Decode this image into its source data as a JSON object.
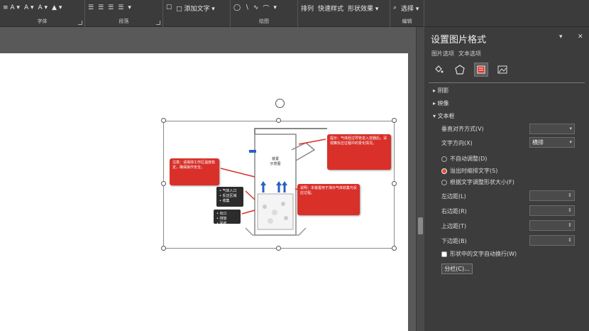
{
  "ribbon": {
    "groups": [
      {
        "label": "字体",
        "tools": [
          "≡ A ▾",
          "A ▾",
          "A ▾",
          "▲ ▾"
        ]
      },
      {
        "label": "段落",
        "tools": [
          "☰",
          "☰",
          "☰",
          "☰",
          "▾"
        ]
      },
      {
        "label": "",
        "tools": [
          "☐",
          "□ 添加文字 ▾"
        ]
      },
      {
        "label": "绘图",
        "tools": [
          "◯",
          "∖",
          "∿",
          "⌒",
          "▾"
        ]
      },
      {
        "label": "",
        "tools": [
          "排列",
          "快速样式",
          "形状效果 ▾"
        ]
      },
      {
        "label": "编辑",
        "tools": [
          "⌕",
          "选择 ▾"
        ]
      }
    ]
  },
  "pane": {
    "title": "设置图片格式",
    "subtabs": [
      "图片选项",
      "文本选项"
    ],
    "close": "✕",
    "dropdown": "▾",
    "sections": {
      "shadow": "阴影",
      "glow": "映像",
      "textbox": "文本框"
    },
    "vertical_align_label": "垂直对齐方式(V)",
    "vertical_align_value": "",
    "text_direction_label": "文字方向(X)",
    "text_direction_value": "横排",
    "radios": [
      {
        "label": "不自动调整(D)",
        "selected": false
      },
      {
        "label": "溢出时缩排文字(S)",
        "selected": true
      },
      {
        "label": "根据文字调整形状大小(F)",
        "selected": false
      }
    ],
    "margins": [
      {
        "label": "左边距(L)",
        "value": ""
      },
      {
        "label": "右边距(R)",
        "value": ""
      },
      {
        "label": "上边距(T)",
        "value": ""
      },
      {
        "label": "下边距(B)",
        "value": ""
      }
    ],
    "wrap_checkbox": "形状中的文字自动换行(W)",
    "columns_button": "分栏(C)..."
  },
  "diagram": {
    "callouts": [
      {
        "text": "注意：请保持工作区温度稳定，确保操作安全。"
      },
      {
        "text": "提示：气体经过导管进入容器后，请观察反应过程中的变化情况。"
      },
      {
        "text": "说明：本装置用于演示气体收集与反应过程。"
      }
    ],
    "dark_boxes": [
      {
        "text": "• 气体入口\n• 反应区域\n• 收集"
      },
      {
        "text": "• 出口\n• 排放\n• 回收"
      }
    ],
    "center_label": "装置\n示意图"
  },
  "colors": {
    "accent": "#d9302a",
    "pane_bg": "#3c3c3c",
    "ribbon_bg": "#3b3b3b"
  }
}
